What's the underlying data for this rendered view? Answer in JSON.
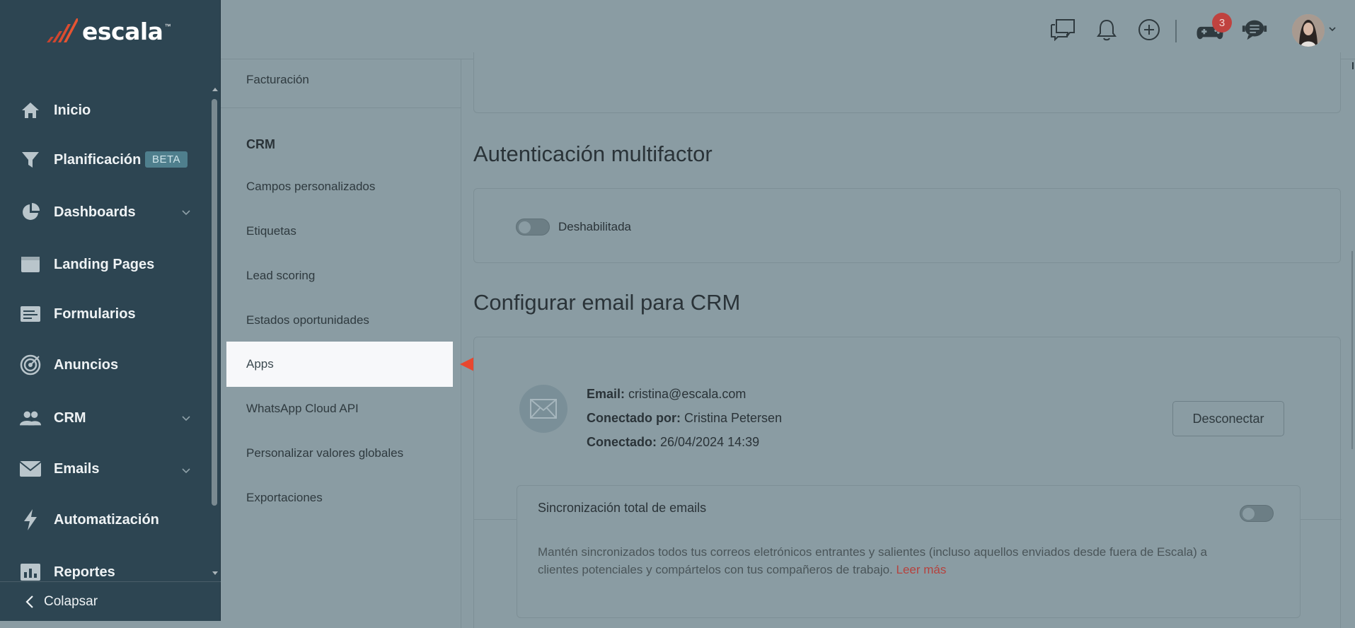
{
  "brand": {
    "name": "escala",
    "tm": "™"
  },
  "sidebar": {
    "items": [
      {
        "label": "Inicio",
        "icon": "home-icon"
      },
      {
        "label": "Planificación",
        "icon": "filter-icon",
        "badge": "BETA"
      },
      {
        "label": "Dashboards",
        "icon": "pie-chart-icon",
        "expandable": true
      },
      {
        "label": "Landing Pages",
        "icon": "browser-window-icon"
      },
      {
        "label": "Formularios",
        "icon": "form-icon"
      },
      {
        "label": "Anuncios",
        "icon": "target-icon"
      },
      {
        "label": "CRM",
        "icon": "people-icon",
        "expandable": true
      },
      {
        "label": "Emails",
        "icon": "envelope-icon",
        "expandable": true
      },
      {
        "label": "Automatización",
        "icon": "lightning-icon"
      },
      {
        "label": "Reportes",
        "icon": "bar-chart-icon"
      }
    ],
    "collapse_label": "Colapsar"
  },
  "header": {
    "icons": [
      "chat-bubbles-icon",
      "bell-icon",
      "plus-circle-icon",
      "gamepad-icon",
      "support-chat-icon"
    ],
    "notification_count": "3"
  },
  "submenu": {
    "top_item": "Facturación",
    "section_heading": "CRM",
    "items": [
      "Campos personalizados",
      "Etiquetas",
      "Lead scoring",
      "Estados oportunidades",
      "Apps",
      "WhatsApp Cloud API",
      "Personalizar valores globales",
      "Exportaciones"
    ],
    "active_item": "Apps"
  },
  "main": {
    "mfa": {
      "title": "Autenticación multifactor",
      "toggle_label": "Deshabilitada",
      "enabled": false
    },
    "email_config": {
      "title": "Configurar email para CRM",
      "email_label": "Email:",
      "email_value": "cristina@escala.com",
      "connected_by_label": "Conectado por:",
      "connected_by_value": "Cristina Petersen",
      "connected_label": "Conectado:",
      "connected_value": "26/04/2024 14:39",
      "disconnect_label": "Desconectar"
    },
    "sync": {
      "title": "Sincronización total de emails",
      "enabled": false,
      "description": "Mantén sincronizados todos tus correos eletrónicos entrantes y salientes (incluso aquellos enviados desde fuera de Escala) a clientes potenciales y compártelos con tus compañeros de trabajo.",
      "read_more": "Leer más"
    }
  },
  "colors": {
    "sidebar_bg": "#2d4552",
    "overlay_bg": "#8a9ca3",
    "highlight_bg": "#f7f8fa",
    "arrow": "#e8472f",
    "badge": "#c0423f",
    "beta_bg": "#4f7f8d"
  }
}
